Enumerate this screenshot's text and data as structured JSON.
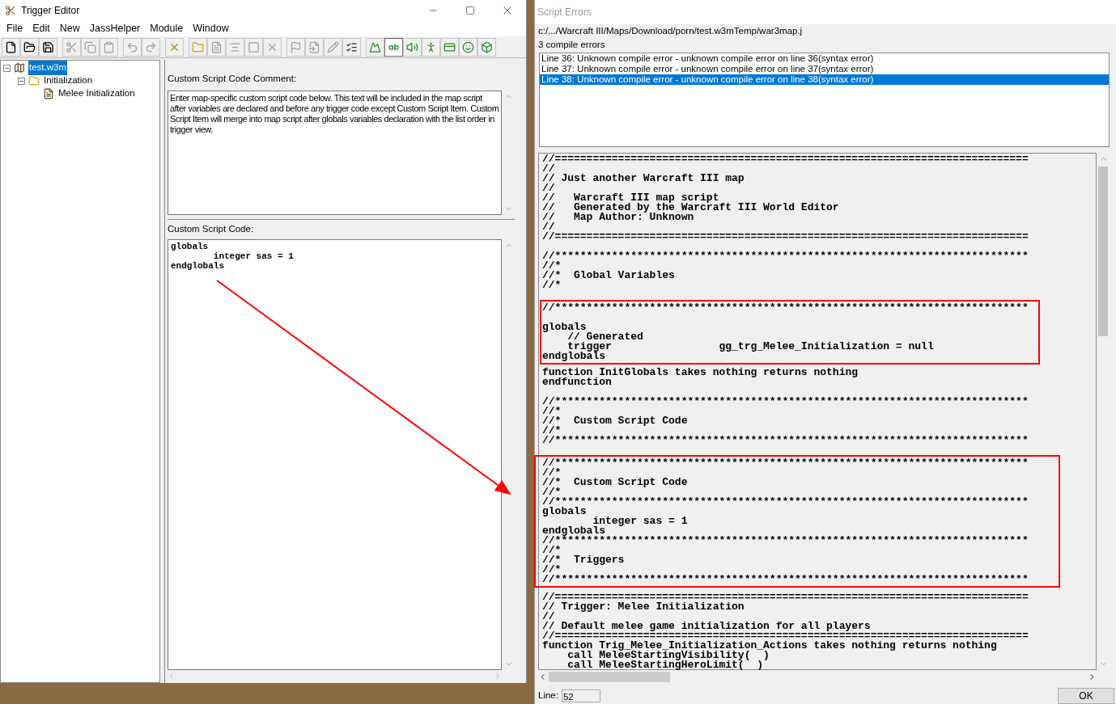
{
  "trigger_editor": {
    "title": "Trigger Editor",
    "menu": [
      "File",
      "Edit",
      "New",
      "JassHelper",
      "Module",
      "Window"
    ],
    "toolbar": [
      [
        {
          "disabled": false,
          "pressed": false
        },
        {
          "disabled": false,
          "pressed": false
        },
        {
          "disabled": false,
          "pressed": false
        }
      ],
      [
        {
          "disabled": true,
          "pressed": false
        },
        {
          "disabled": true,
          "pressed": false
        },
        {
          "disabled": true,
          "pressed": false
        }
      ],
      [
        {
          "disabled": true,
          "pressed": false
        },
        {
          "disabled": true,
          "pressed": false
        }
      ],
      [
        {
          "disabled": false,
          "pressed": false
        }
      ],
      [
        {
          "disabled": false,
          "pressed": false
        },
        {
          "disabled": true,
          "pressed": false
        },
        {
          "disabled": true,
          "pressed": false
        },
        {
          "disabled": true,
          "pressed": false
        },
        {
          "disabled": true,
          "pressed": false
        }
      ],
      [
        {
          "disabled": true,
          "pressed": false
        },
        {
          "disabled": true,
          "pressed": false
        },
        {
          "disabled": true,
          "pressed": false
        },
        {
          "disabled": false,
          "pressed": false
        }
      ],
      [
        {
          "disabled": false,
          "pressed": false
        },
        {
          "disabled": false,
          "pressed": true
        },
        {
          "disabled": false,
          "pressed": false
        },
        {
          "disabled": false,
          "pressed": false
        },
        {
          "disabled": false,
          "pressed": false
        },
        {
          "disabled": false,
          "pressed": false
        },
        {
          "disabled": false,
          "pressed": false
        }
      ]
    ],
    "tree": [
      {
        "label": "test.w3m",
        "kind": "map",
        "selected": true,
        "expanded": true,
        "children": [
          {
            "label": "Initialization",
            "kind": "folder",
            "selected": false,
            "expanded": true,
            "children": [
              {
                "label": "Melee Initialization",
                "kind": "trigger",
                "selected": false
              }
            ]
          }
        ]
      }
    ],
    "comment_label": "Custom Script Code Comment:",
    "comment": "Enter map-specific custom script code below.  This text will be included in the map script after variables are declared and before any trigger code except Custom Script Item. Custom Script Item will merge into map script after globals variables declaration with the list order in trigger view.",
    "code_label": "Custom Script Code:",
    "code": [
      "globals",
      "        integer sas = 1",
      "endglobals"
    ]
  },
  "script_errors": {
    "title": "Script Errors",
    "path": "c:/.../Warcraft III/Maps/Download/porn/test.w3mTemp/war3map.j",
    "summary": "3 compile errors",
    "errors": [
      {
        "text": "Line  36: Unknown compile error - unknown compile error on line 36(syntax error)",
        "selected": false
      },
      {
        "text": "Line  37: Unknown compile error - unknown compile error on line 37(syntax error)",
        "selected": false
      },
      {
        "text": "Line  38: Unknown compile error - unknown compile error on line 38(syntax error)",
        "selected": true
      }
    ],
    "script_sections": [
      {
        "boxed": false,
        "groups": [
          [
            "//===========================================================================",
            "//",
            "// Just another Warcraft III map",
            "//",
            "//   Warcraft III map script",
            "//   Generated by the Warcraft III World Editor",
            "//   Map Author: Unknown",
            "//",
            "//==========================================================================="
          ],
          [
            "//***************************************************************************",
            "//*",
            "//*  Global Variables",
            "//*"
          ]
        ]
      },
      {
        "boxed": true,
        "groups": [
          [
            "//***************************************************************************"
          ],
          [
            "globals",
            "    // Generated",
            "    trigger                 gg_trg_Melee_Initialization = null",
            "endglobals"
          ]
        ]
      },
      {
        "boxed": false,
        "groups": [
          [
            "function InitGlobals takes nothing returns nothing",
            "endfunction"
          ],
          [
            "//***************************************************************************",
            "//*",
            "//*  Custom Script Code",
            "//*",
            "//***************************************************************************"
          ]
        ]
      },
      {
        "boxed": true,
        "groups": [
          [
            "//***************************************************************************",
            "//*",
            "//*  Custom Script Code",
            "//*",
            "//***************************************************************************",
            "globals",
            "        integer sas = 1",
            "endglobals",
            "//***************************************************************************",
            "//*",
            "//*  Triggers",
            "//*",
            "//***************************************************************************"
          ]
        ]
      },
      {
        "boxed": false,
        "groups": [
          [
            "//===========================================================================",
            "// Trigger: Melee Initialization",
            "//",
            "// Default melee game initialization for all players",
            "//===========================================================================",
            "function Trig_Melee_Initialization_Actions takes nothing returns nothing",
            "    call MeleeStartingVisibility(  )",
            "    call MeleeStartingHeroLimit(  )"
          ]
        ]
      }
    ],
    "line_label": "Line:",
    "line_value": "52",
    "ok_button": "OK"
  }
}
